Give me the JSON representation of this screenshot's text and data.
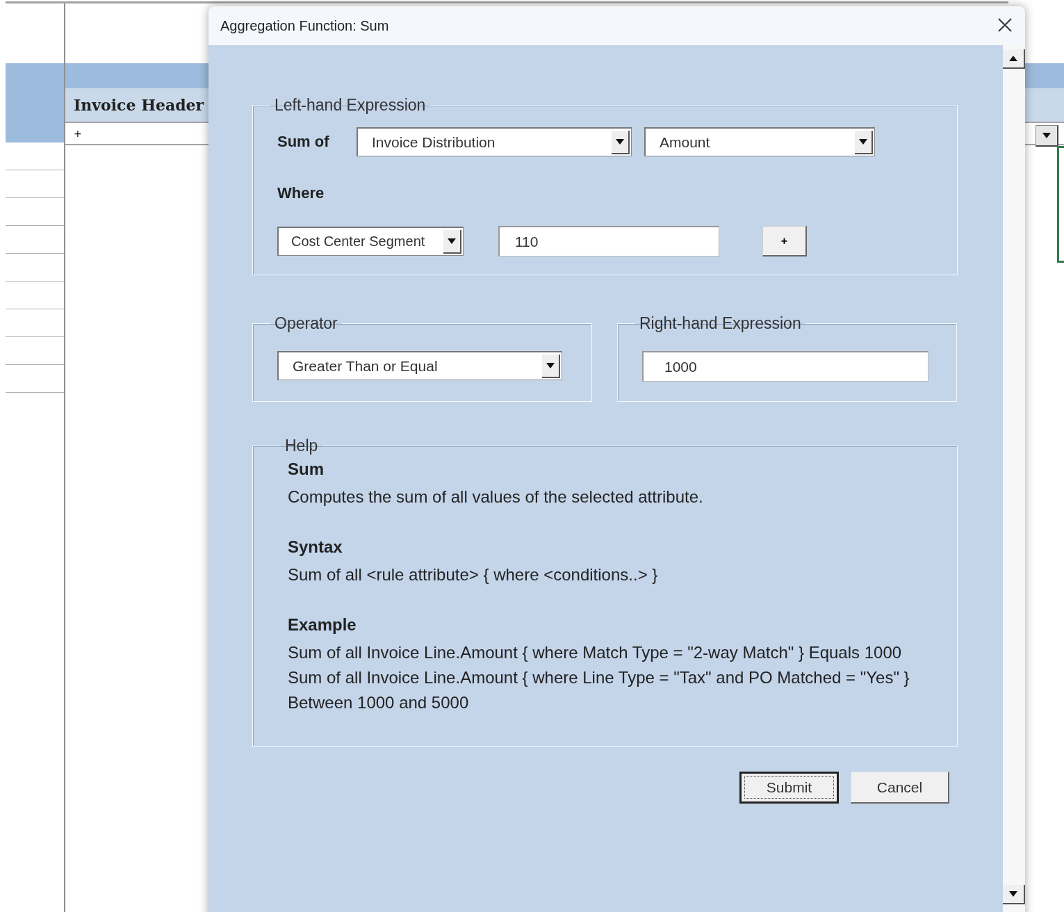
{
  "sheet": {
    "column_header": "Invoice Header",
    "filter_value": "+"
  },
  "dialog": {
    "title": "Aggregation Function: Sum",
    "left_group": {
      "title": "Left-hand Expression",
      "sum_label": "Sum of",
      "entity": "Invoice Distribution",
      "attribute": "Amount",
      "where_label": "Where",
      "where_attribute": "Cost Center Segment",
      "where_value": "110",
      "add_button": "+"
    },
    "operator_group": {
      "title": "Operator",
      "value": "Greater Than or Equal"
    },
    "right_group": {
      "title": "Right-hand Expression",
      "value": "1000"
    },
    "help": {
      "title": "Help",
      "sections": [
        {
          "heading": "Sum",
          "lines": [
            "Computes the sum of all values of the selected attribute."
          ]
        },
        {
          "heading": "Syntax",
          "lines": [
            "Sum of all <rule attribute> { where <conditions..> }"
          ]
        },
        {
          "heading": "Example",
          "lines": [
            "Sum of all Invoice Line.Amount { where Match Type = \"2-way Match\" } Equals 1000",
            "Sum of all Invoice Line.Amount { where Line Type = \"Tax\" and PO Matched = \"Yes\" } Between 1000 and 5000"
          ]
        }
      ]
    },
    "buttons": [
      {
        "label": "Submit",
        "default": true
      },
      {
        "label": "Cancel",
        "default": false
      }
    ]
  }
}
